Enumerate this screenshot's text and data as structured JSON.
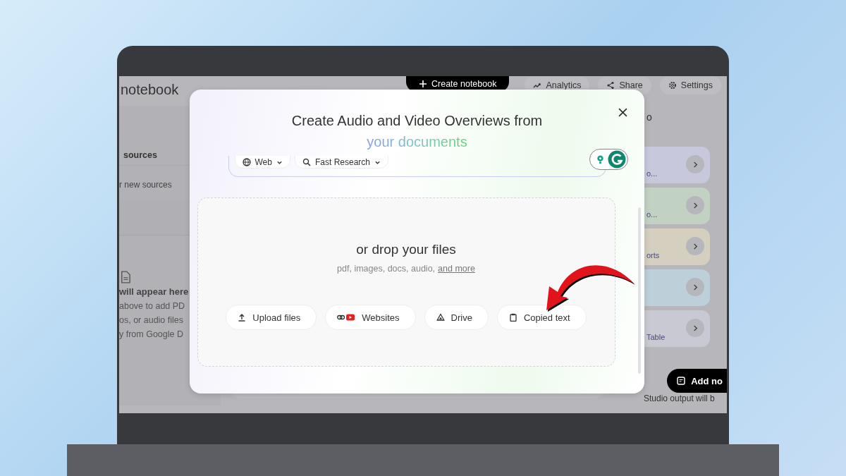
{
  "app": {
    "title": "notebook",
    "top_actions": [
      {
        "label": "Create notebook",
        "kind": "create"
      },
      {
        "label": "Analytics",
        "kind": "analytics"
      },
      {
        "label": "Share",
        "kind": "share"
      },
      {
        "label": "Settings",
        "kind": "settings"
      }
    ]
  },
  "sources_panel": {
    "search_value": "sources",
    "hint": "r new sources",
    "empty_title": "will appear here",
    "empty_lines": [
      "above to add PD",
      "os, or audio files",
      "y from Google D"
    ]
  },
  "studio_panel": {
    "header": "o",
    "cards": [
      {
        "label": "o...",
        "color": "#c7c8dc"
      },
      {
        "label": "o...",
        "color": "#c2d2c2"
      },
      {
        "label": "orts",
        "color": "#d5cfbf"
      },
      {
        "color": "#bdcfd8"
      },
      {
        "label": "Table",
        "color": "#c9c9d3"
      }
    ],
    "add_note": "Add no",
    "footer": "Studio output will b"
  },
  "dialog": {
    "title": "Create Audio and Video Overviews from",
    "title_highlight": "your documents",
    "chips": [
      {
        "label": "Web",
        "kind": "web"
      },
      {
        "label": "Fast Research",
        "kind": "research"
      }
    ],
    "drop_heading": "or drop your files",
    "formats": "pdf, images, docs, audio,",
    "more_link": "and more",
    "buttons": [
      {
        "label": "Upload files",
        "kind": "upload"
      },
      {
        "label": "Websites",
        "kind": "websites"
      },
      {
        "label": "Drive",
        "kind": "drive"
      },
      {
        "label": "Copied text",
        "kind": "text"
      }
    ]
  }
}
